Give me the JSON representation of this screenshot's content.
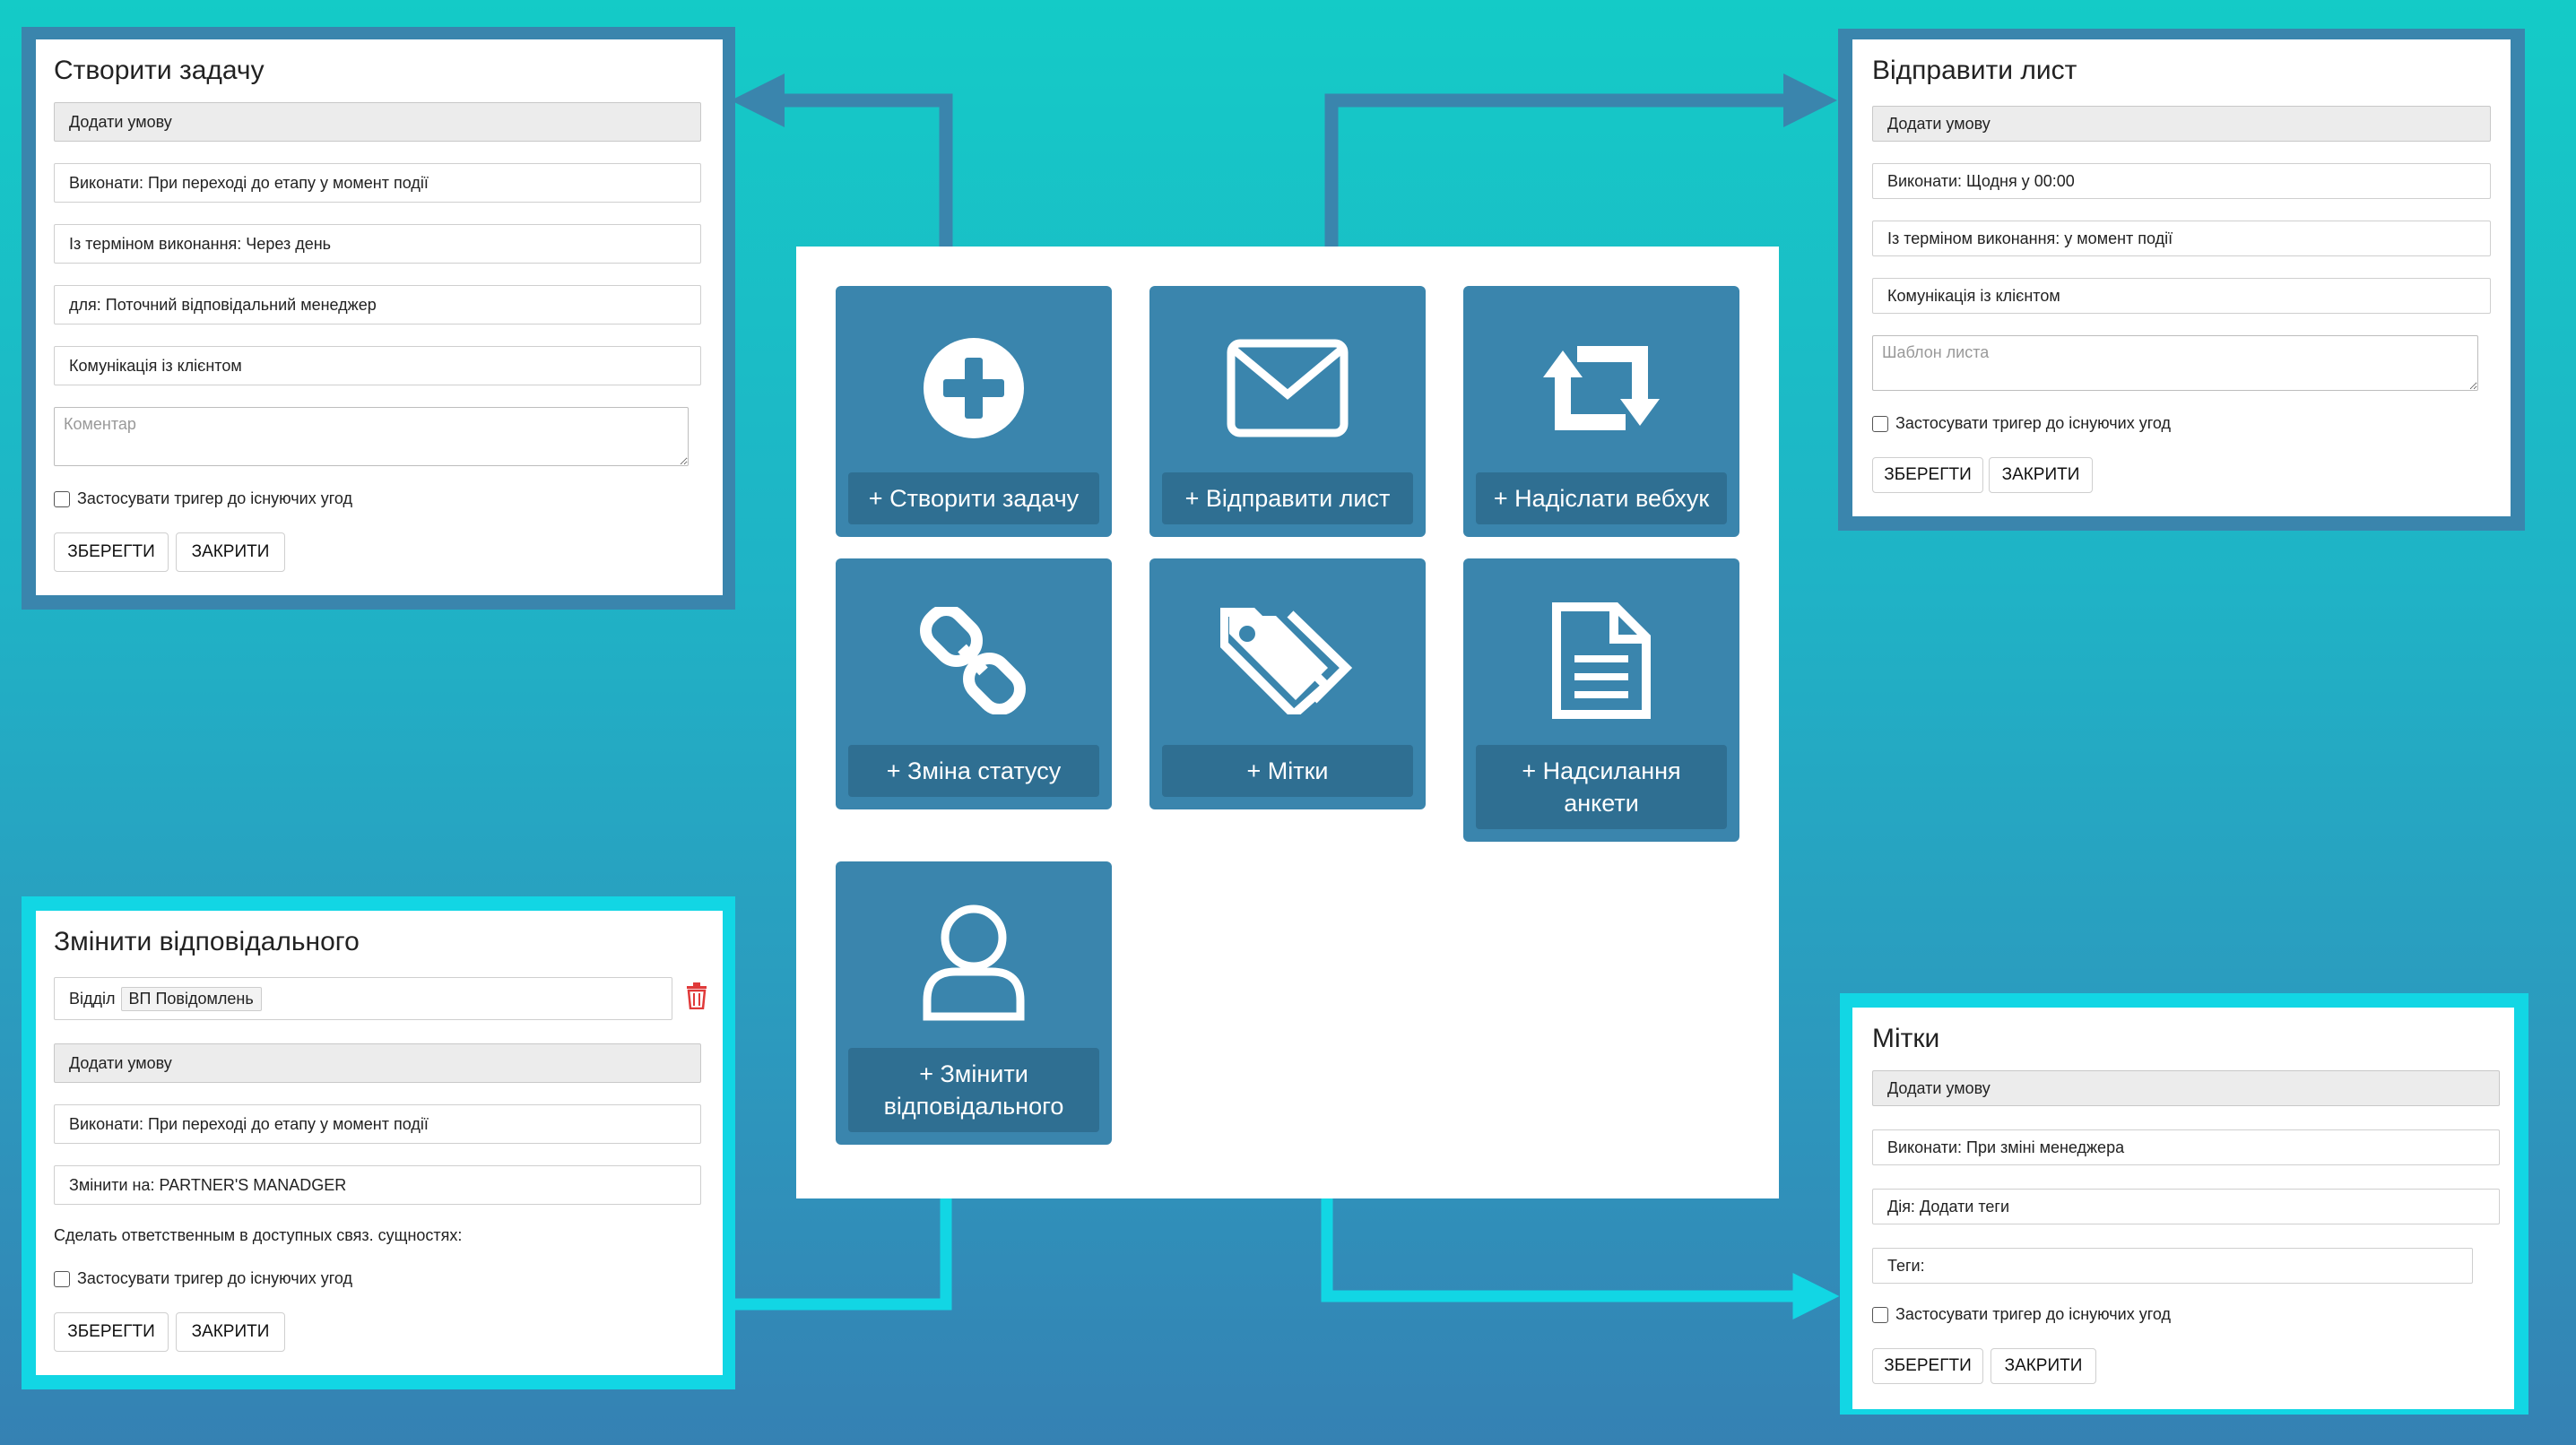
{
  "colors": {
    "bg_top": "#14cbc7",
    "bg_bottom": "#3581b3",
    "tile": "#3a85ad",
    "tile_button": "#2f6f92",
    "arrow_dark": "#3a85ad",
    "arrow_cyan": "#12d6e4",
    "delete": "#e03a3a"
  },
  "tiles": [
    {
      "icon": "plus-circle-icon",
      "label": "+ Створити задачу"
    },
    {
      "icon": "envelope-icon",
      "label": "+ Відправити лист"
    },
    {
      "icon": "retweet-icon",
      "label": "+ Надіслати вебхук"
    },
    {
      "icon": "link-icon",
      "label": "+ Зміна статусу"
    },
    {
      "icon": "tags-icon",
      "label": "+ Мітки"
    },
    {
      "icon": "file-text-icon",
      "label": "+ Надсилання\nанкети"
    },
    {
      "icon": "user-icon",
      "label": "+ Змінити\nвідповідального"
    }
  ],
  "panels": {
    "task": {
      "title": "Створити задачу",
      "add_condition": "Додати умову",
      "execute": "Виконати: При переході до етапу у момент події",
      "deadline": "Із терміном виконання: Через день",
      "for": "для: Поточний відповідальний менеджер",
      "type": "Комунікація із клієнтом",
      "comment_placeholder": "Коментар",
      "apply": "Застосувати тригер до існуючих угод",
      "save": "ЗБЕРЕГТИ",
      "close": "ЗАКРИТИ"
    },
    "email": {
      "title": "Відправити лист",
      "add_condition": "Додати умову",
      "execute": "Виконати: Щодня у 00:00",
      "deadline": "Із терміном виконання: у момент події",
      "type": "Комунікація із клієнтом",
      "template_placeholder": "Шаблон листа",
      "apply": "Застосувати тригер до існуючих угод",
      "save": "ЗБЕРЕГТИ",
      "close": "ЗАКРИТИ"
    },
    "responsible": {
      "title": "Змінити відповідального",
      "dept_label": "Відділ",
      "dept_tag": "ВП Повідомлень",
      "add_condition": "Додати умову",
      "execute": "Виконати: При переході до етапу у момент події",
      "change_to": "Змінити на: PARTNER'S MANADGER",
      "note": "Сделать ответственным в доступных связ. сущностях:",
      "apply": "Застосувати тригер до існуючих угод",
      "save": "ЗБЕРЕГТИ",
      "close": "ЗАКРИТИ"
    },
    "tags": {
      "title": "Мітки",
      "add_condition": "Додати умову",
      "execute": "Виконати: При зміні менеджера",
      "action": "Дія: Додати теги",
      "tags_field": "Теги:",
      "apply": "Застосувати тригер до існуючих угод",
      "save": "ЗБЕРЕГТИ",
      "close": "ЗАКРИТИ"
    }
  }
}
